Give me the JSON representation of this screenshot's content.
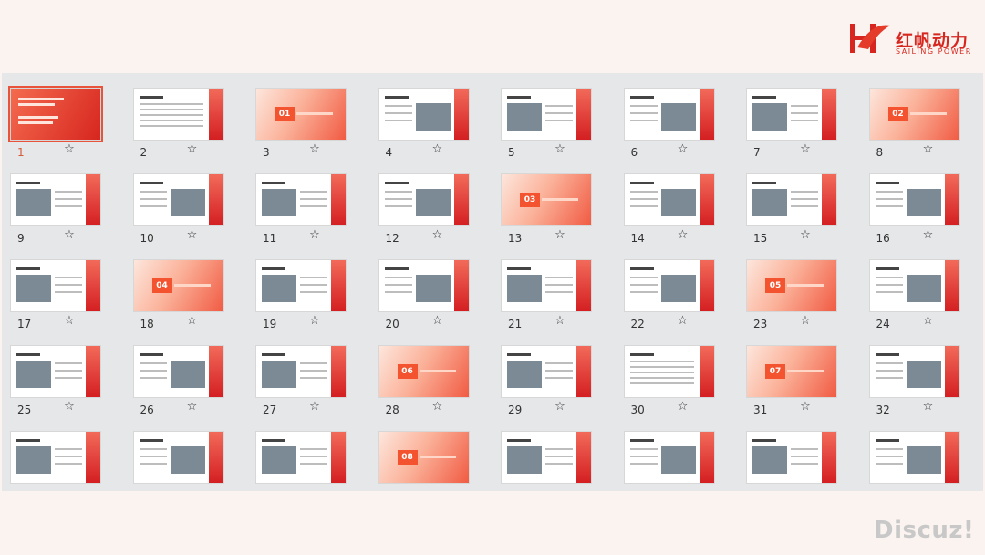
{
  "brand": {
    "name_cn": "红帆动力",
    "name_en": "SAILING POWER",
    "color": "#d7261f"
  },
  "slides": [
    {
      "num": "1",
      "type": "title",
      "selected": true
    },
    {
      "num": "2",
      "type": "text"
    },
    {
      "num": "3",
      "type": "section",
      "section": "01"
    },
    {
      "num": "4",
      "type": "image"
    },
    {
      "num": "5",
      "type": "image"
    },
    {
      "num": "6",
      "type": "image"
    },
    {
      "num": "7",
      "type": "image"
    },
    {
      "num": "8",
      "type": "section",
      "section": "02"
    },
    {
      "num": "9",
      "type": "image"
    },
    {
      "num": "10",
      "type": "image"
    },
    {
      "num": "11",
      "type": "image"
    },
    {
      "num": "12",
      "type": "image"
    },
    {
      "num": "13",
      "type": "section",
      "section": "03"
    },
    {
      "num": "14",
      "type": "image"
    },
    {
      "num": "15",
      "type": "image"
    },
    {
      "num": "16",
      "type": "image"
    },
    {
      "num": "17",
      "type": "image"
    },
    {
      "num": "18",
      "type": "section",
      "section": "04"
    },
    {
      "num": "19",
      "type": "image"
    },
    {
      "num": "20",
      "type": "image"
    },
    {
      "num": "21",
      "type": "image"
    },
    {
      "num": "22",
      "type": "image"
    },
    {
      "num": "23",
      "type": "section",
      "section": "05"
    },
    {
      "num": "24",
      "type": "image"
    },
    {
      "num": "25",
      "type": "image"
    },
    {
      "num": "26",
      "type": "image"
    },
    {
      "num": "27",
      "type": "image"
    },
    {
      "num": "28",
      "type": "section",
      "section": "06"
    },
    {
      "num": "29",
      "type": "image"
    },
    {
      "num": "30",
      "type": "text"
    },
    {
      "num": "31",
      "type": "section",
      "section": "07"
    },
    {
      "num": "32",
      "type": "image"
    },
    {
      "num": "",
      "type": "image"
    },
    {
      "num": "",
      "type": "image"
    },
    {
      "num": "",
      "type": "image"
    },
    {
      "num": "",
      "type": "section",
      "section": "08"
    },
    {
      "num": "",
      "type": "image"
    },
    {
      "num": "",
      "type": "image"
    },
    {
      "num": "",
      "type": "image"
    },
    {
      "num": "",
      "type": "image"
    }
  ],
  "icons": {
    "favorite": "star-outline-icon"
  },
  "watermark": "Discuz!"
}
